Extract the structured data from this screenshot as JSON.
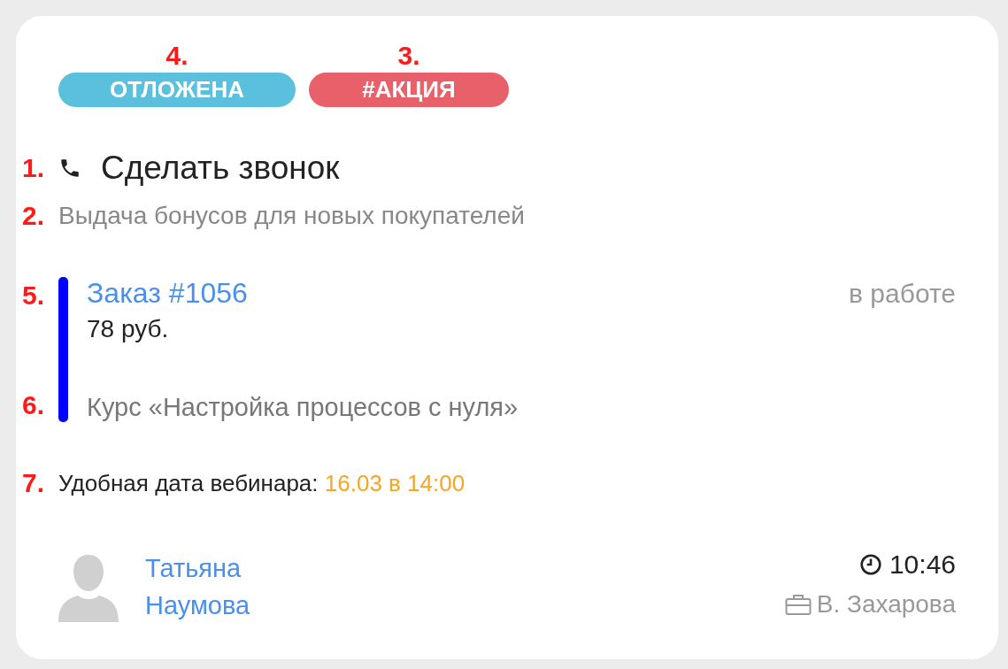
{
  "tags": [
    {
      "label": "ОТЛОЖЕНА",
      "marker": "4.",
      "color": "#5bc0de"
    },
    {
      "label": "#АКЦИЯ",
      "marker": "3.",
      "color": "#e8606a"
    }
  ],
  "task": {
    "marker": "1.",
    "title": "Сделать звонок"
  },
  "description": {
    "marker": "2.",
    "text": "Выдача бонусов для новых покупателей"
  },
  "order": {
    "marker": "5.",
    "link": "Заказ #1056",
    "status": "в работе",
    "amount": "78 руб.",
    "product_marker": "6.",
    "product": "Курс «Настройка процессов с нуля»"
  },
  "webinar": {
    "marker": "7.",
    "label": "Удобная дата вебинара:",
    "value": "16.03 в 14:00"
  },
  "contact": {
    "name": "Татьяна Наумова"
  },
  "time": "10:46",
  "manager": "В. Захарова"
}
